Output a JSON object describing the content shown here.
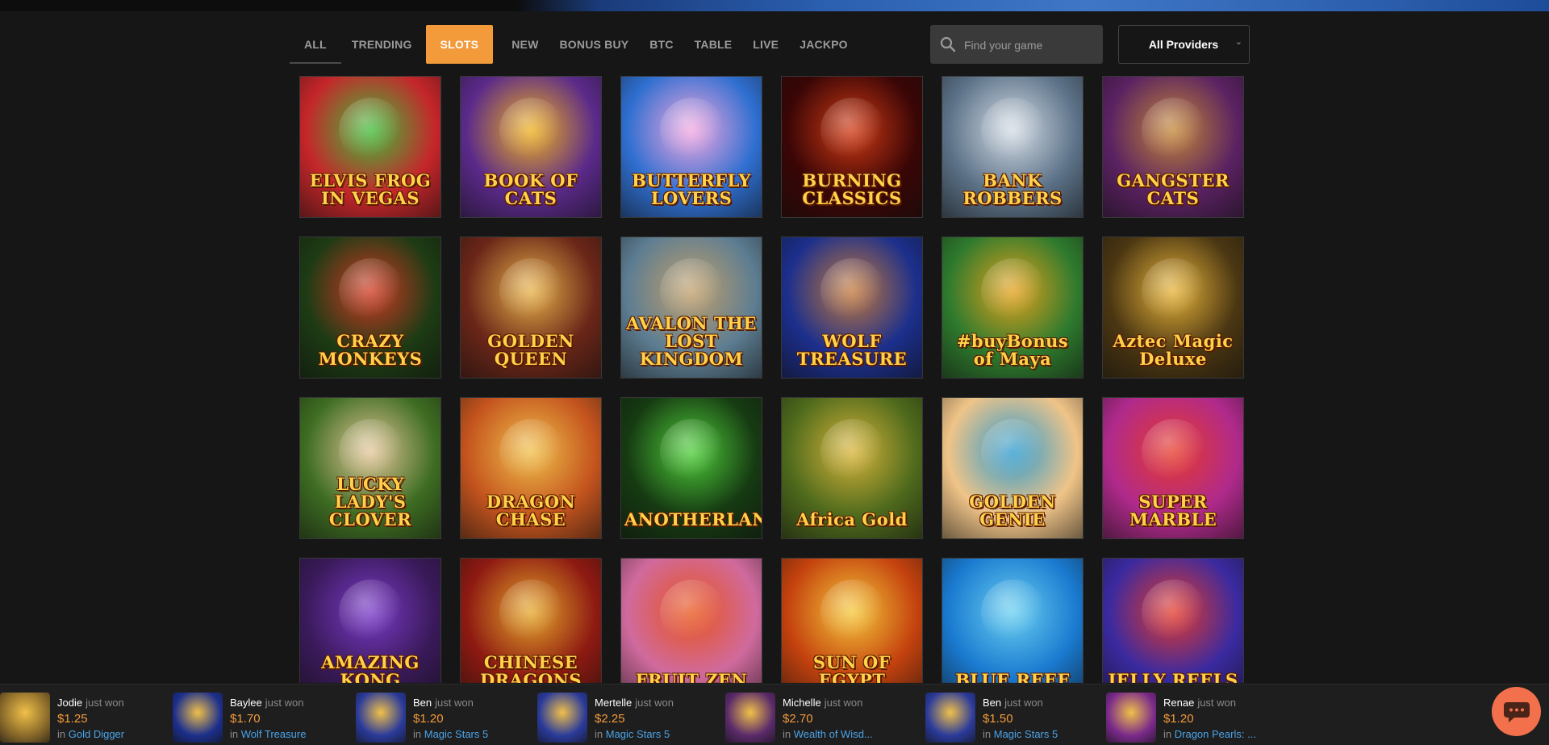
{
  "nav": {
    "tabs": [
      {
        "label": "ALL",
        "state": "underlined"
      },
      {
        "label": "TRENDING"
      },
      {
        "label": "SLOTS",
        "state": "active"
      },
      {
        "label": "NEW"
      },
      {
        "label": "BONUS BUY"
      },
      {
        "label": "BTC"
      },
      {
        "label": "TABLE"
      },
      {
        "label": "LIVE"
      },
      {
        "label": "JACKPOT"
      }
    ]
  },
  "search": {
    "placeholder": "Find your game",
    "value": "",
    "icon": "search-icon"
  },
  "providers": {
    "label": "All Providers",
    "icon": "chevron-down-icon"
  },
  "games": [
    {
      "title": "ELVIS FROG IN VEGAS",
      "bg": "#c5262a",
      "accent": "#3fbf3a"
    },
    {
      "title": "BOOK OF CATS",
      "bg": "#5b2a8a",
      "accent": "#f0b21e"
    },
    {
      "title": "BUTTERFLY LOVERS",
      "bg": "#2f6fd0",
      "accent": "#f5a8e0"
    },
    {
      "title": "BURNING CLASSICS",
      "bg": "#3a0606",
      "accent": "#d23a14"
    },
    {
      "title": "BANK ROBBERS",
      "bg": "#5c7288",
      "accent": "#d5dde6"
    },
    {
      "title": "GANGSTER CATS",
      "bg": "#5a2262",
      "accent": "#c48736"
    },
    {
      "title": "CRAZY MONKEYS",
      "bg": "#1d3b14",
      "accent": "#d33a24"
    },
    {
      "title": "GOLDEN QUEEN",
      "bg": "#6a2618",
      "accent": "#e8b34a"
    },
    {
      "title": "AVALON THE LOST KINGDOM",
      "bg": "#5d7d92",
      "accent": "#c2a06a"
    },
    {
      "title": "WOLF TREASURE",
      "bg": "#1c2f8c",
      "accent": "#c57a3a"
    },
    {
      "title": "#buyBonus of Maya",
      "bg": "#2e7a2e",
      "accent": "#e6a21c"
    },
    {
      "title": "Aztec Magic Deluxe",
      "bg": "#4a3612",
      "accent": "#e8b43a"
    },
    {
      "title": "LUCKY LADY'S CLOVER",
      "bg": "#3e6d22",
      "accent": "#e6c79a"
    },
    {
      "title": "DRAGON CHASE",
      "bg": "#c4541e",
      "accent": "#f0c04a"
    },
    {
      "title": "ANOTHERLAND",
      "bg": "#163a12",
      "accent": "#4fcf3a"
    },
    {
      "title": "Africa Gold",
      "bg": "#4e6a1c",
      "accent": "#d8b43a"
    },
    {
      "title": "GOLDEN GENIE",
      "bg": "#f0c488",
      "accent": "#2a9ad0"
    },
    {
      "title": "SUPER MARBLE",
      "bg": "#b02a8c",
      "accent": "#e63a2a"
    },
    {
      "title": "AMAZING KONG",
      "bg": "#3a1a5a",
      "accent": "#7a3ac8"
    },
    {
      "title": "CHINESE DRAGONS",
      "bg": "#8e1a12",
      "accent": "#e6a82a"
    },
    {
      "title": "FRUIT ZEN",
      "bg": "#d06a9e",
      "accent": "#e8541a"
    },
    {
      "title": "SUN OF EGYPT",
      "bg": "#c4420e",
      "accent": "#f5c83a"
    },
    {
      "title": "BLUE REEF",
      "bg": "#1a7ad0",
      "accent": "#6ad0f0"
    },
    {
      "title": "JELLY REELS",
      "bg": "#3a2aa0",
      "accent": "#e63a2a"
    }
  ],
  "ticker": [
    {
      "name": "Jodie",
      "action": "just won",
      "amount": "$1.25",
      "prefix": "in",
      "game": "Gold Digger",
      "color": "#8a6a2a"
    },
    {
      "name": "Baylee",
      "action": "just won",
      "amount": "$1.70",
      "prefix": "in",
      "game": "Wolf Treasure",
      "color": "#1c2f8c"
    },
    {
      "name": "Ben",
      "action": "just won",
      "amount": "$1.20",
      "prefix": "in",
      "game": "Magic Stars 5",
      "color": "#2a3a9a"
    },
    {
      "name": "Mertelle",
      "action": "just won",
      "amount": "$2.25",
      "prefix": "in",
      "game": "Magic Stars 5",
      "color": "#2a3a9a"
    },
    {
      "name": "Michelle",
      "action": "just won",
      "amount": "$2.70",
      "prefix": "in",
      "game": "Wealth of Wisd...",
      "color": "#5a2a6a"
    },
    {
      "name": "Ben",
      "action": "just won",
      "amount": "$1.50",
      "prefix": "in",
      "game": "Magic Stars 5",
      "color": "#2a3a9a"
    },
    {
      "name": "Renae",
      "action": "just won",
      "amount": "$1.20",
      "prefix": "in",
      "game": "Dragon Pearls: ...",
      "color": "#7a2a8a"
    }
  ],
  "chat": {
    "icon": "chat-bubble-icon"
  },
  "colors": {
    "accent": "#f39a3a",
    "link": "#4aa3e8",
    "background": "#161616"
  }
}
